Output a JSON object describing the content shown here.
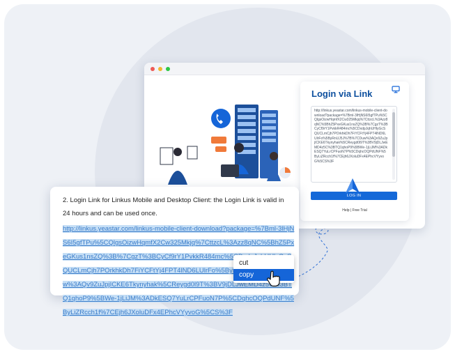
{
  "login_card": {
    "title": "Login via Link",
    "link_text": "http://linkus.yeastar.com/linkus-mobile-client-download?package=%7Bml-3lHjNS6I5gfTPu%5CQlgsOizwHqmfX2Cw325Mkjq%7CttzcL%3Azz8qNC%5BhZ5PxeGKus1nsZQ%3B%7CgzT%3BCyCf9rY1PvkkR484mc%5CDxdpJqhUHlyGcSQUCLmCjh7POrkhkDh7FiYCFtYj4FPT4lND6LUlrFo%5ByRnUJ5J%7B%7CDuw%3AQv9ZuJpjICKE6Tkynyhak%5CReygd0l9T%3BV9jDLJwEMD4z5C%3BTQ1qhoP9%5BWe-1jLiJM%3ADkESQ7YuLrCPFuoN7P%5CDqhcOQPdUNF%5ByLiZRcch1f%7CEjh6JXoluDFx4EPhcVYyvoG%5CS%3F",
    "login_button": "LOG IN",
    "help_text": "Help | Free Trial"
  },
  "panel": {
    "heading": "2. Login Link for Linkus Mobile and Desktop Client: the Login Link is valid in 24 hours and can be used once.",
    "link": "http://linkus.yeastar.com/linkus-mobile-client-download?package=%7Bml-3lHjNS6I5gfTPu%5CQlgsOizwHqmfX2Cw325Mkjq%7CttzcL%3Azz8qNC%5BhZ5PxeGKus1nsZQ%3B%7CgzT%3BCyCf9rY1PvkkR484mc%5CDxdpJqhUHlyGcSQUCLmCjh7POrkhkDh7FiYCFtYj4FPT4lND6LUlrFo%5ByRnUJ5J%7B%7CDuw%3AQv9ZuJpjICKE6Tkynyhak%5CReygd0l9T%3BV9jDLJwEMD4z5C%3BTQ1qhoP9%5BWe-1jLiJM%3ADkESQ7YuLrCPFuoN7P%5CDqhcOQPdUNF%5ByLiZRcch1f%7CEjh6JXoluDFx4EPhcVYyvoG%5CS%3F"
  },
  "context_menu": {
    "cut": "cut",
    "copy": "copy"
  },
  "colors": {
    "brand_blue": "#1468d8",
    "title_blue": "#0d4f9e",
    "selection": "#c6dff6"
  }
}
